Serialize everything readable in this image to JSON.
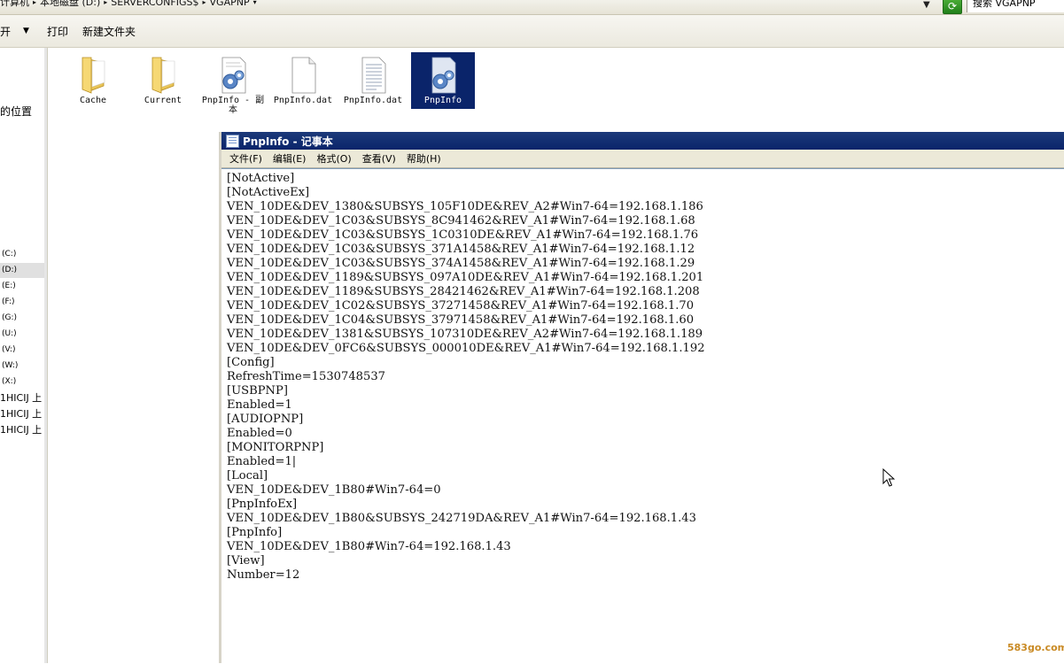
{
  "address_bar": {
    "crumbs": [
      "计算机",
      "本地磁盘 (D:)",
      "SERVERCONFIGS$",
      "VGAPNP"
    ],
    "search_placeholder": "搜索 VGAPNP"
  },
  "toolbar": {
    "open_label": "开",
    "print_label": "打印",
    "new_folder_label": "新建文件夹"
  },
  "nav": {
    "location_label": "的位置",
    "drives": [
      "(C:)",
      "(D:)",
      "(E:)",
      "(F:)",
      "(G:)",
      "(U:)",
      "(V:)",
      "(W:)",
      "(X:)"
    ],
    "selected_drive": "(D:)",
    "network_locations": [
      "1HICIJ 上",
      "1HICIJ 上",
      "1HICIJ 上"
    ]
  },
  "files": [
    {
      "name": "Cache",
      "type": "folder"
    },
    {
      "name": "Current",
      "type": "folder"
    },
    {
      "name": "PnpInfo - 副本",
      "type": "config"
    },
    {
      "name": "PnpInfo.dat",
      "type": "blank"
    },
    {
      "name": "PnpInfo.dat",
      "type": "text"
    },
    {
      "name": "PnpInfo",
      "type": "config",
      "selected": true
    }
  ],
  "notepad": {
    "title": "PnpInfo - 记事本",
    "menu": [
      "文件(F)",
      "编辑(E)",
      "格式(O)",
      "查看(V)",
      "帮助(H)"
    ],
    "lines": [
      "[NotActive]",
      "[NotActiveEx]",
      "VEN_10DE&DEV_1380&SUBSYS_105F10DE&REV_A2#Win7-64=192.168.1.186",
      "VEN_10DE&DEV_1C03&SUBSYS_8C941462&REV_A1#Win7-64=192.168.1.68",
      "VEN_10DE&DEV_1C03&SUBSYS_1C0310DE&REV_A1#Win7-64=192.168.1.76",
      "VEN_10DE&DEV_1C03&SUBSYS_371A1458&REV_A1#Win7-64=192.168.1.12",
      "VEN_10DE&DEV_1C03&SUBSYS_374A1458&REV_A1#Win7-64=192.168.1.29",
      "VEN_10DE&DEV_1189&SUBSYS_097A10DE&REV_A1#Win7-64=192.168.1.201",
      "VEN_10DE&DEV_1189&SUBSYS_28421462&REV_A1#Win7-64=192.168.1.208",
      "VEN_10DE&DEV_1C02&SUBSYS_37271458&REV_A1#Win7-64=192.168.1.70",
      "VEN_10DE&DEV_1C04&SUBSYS_37971458&REV_A1#Win7-64=192.168.1.60",
      "VEN_10DE&DEV_1381&SUBSYS_107310DE&REV_A2#Win7-64=192.168.1.189",
      "VEN_10DE&DEV_0FC6&SUBSYS_000010DE&REV_A1#Win7-64=192.168.1.192",
      "[Config]",
      "RefreshTime=1530748537",
      "[USBPNP]",
      "Enabled=1",
      "[AUDIOPNP]",
      "Enabled=0",
      "[MONITORPNP]",
      "Enabled=1|",
      "[Local]",
      "VEN_10DE&DEV_1B80#Win7-64=0",
      "[PnpInfoEx]",
      "VEN_10DE&DEV_1B80&SUBSYS_242719DA&REV_A1#Win7-64=192.168.1.43",
      "[PnpInfo]",
      "VEN_10DE&DEV_1B80#Win7-64=192.168.1.43",
      "[View]",
      "Number=12"
    ]
  },
  "watermark": "583go.com",
  "colors": {
    "selection": "#0a246a",
    "titlebar": "#0a246a",
    "menubar": "#ece9d8",
    "watermark": "#c98a24"
  }
}
